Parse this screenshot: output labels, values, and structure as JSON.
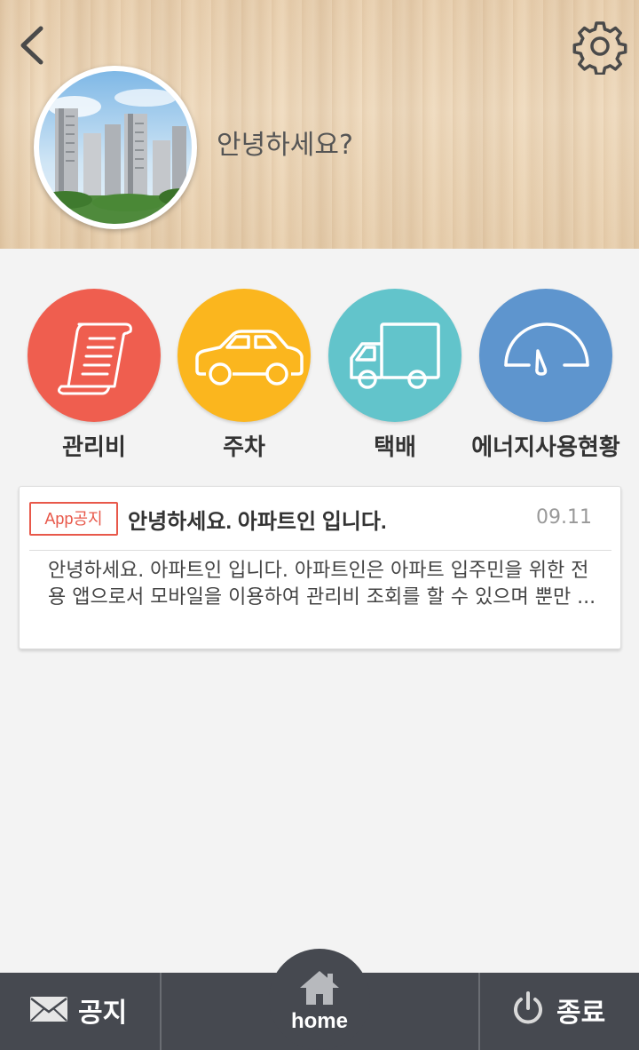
{
  "header": {
    "greeting": "안녕하세요?",
    "back_icon": "chevron-left-icon",
    "settings_icon": "gear-icon",
    "avatar_image": "apartment-buildings"
  },
  "quick_menu": [
    {
      "label": "관리비",
      "icon": "bill-receipt-icon",
      "color": "#ef5e4f"
    },
    {
      "label": "주차",
      "icon": "car-icon",
      "color": "#fbb61e"
    },
    {
      "label": "택배",
      "icon": "delivery-truck-icon",
      "color": "#62c4cb"
    },
    {
      "label": "에너지사용현황",
      "icon": "gauge-icon",
      "color": "#5e95ce"
    }
  ],
  "notice": {
    "badge": "App공지",
    "title": "안녕하세요. 아파트인 입니다.",
    "date": "09.11",
    "body": "안녕하세요. 아파트인 입니다. 아파트인은 아파트 입주민을 위한 전용 앱으로서 모바일을 이용하여 관리비 조회를 할 수 있으며 뿐만 ..."
  },
  "bottom_nav": {
    "notice_label": "공지",
    "notice_icon": "envelope-icon",
    "home_label": "home",
    "home_icon": "house-icon",
    "exit_label": "종료",
    "exit_icon": "power-icon"
  }
}
